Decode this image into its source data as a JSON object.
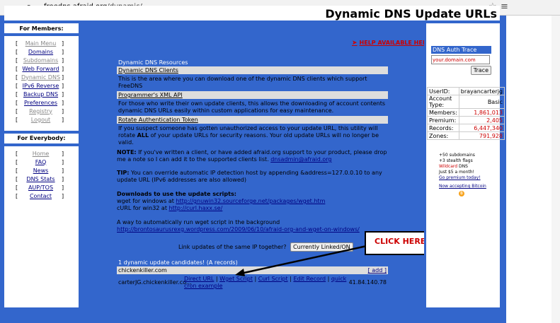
{
  "browser": {
    "url_host": "freedns.afraid.org",
    "url_path": "/dynamic/"
  },
  "header": {
    "title": "Dynamic DNS Update URLs"
  },
  "help_link": "HELP AVAILABLE HERE",
  "members": {
    "title": "For Members:",
    "items": [
      {
        "label": "Main Menu",
        "grey": true
      },
      {
        "label": "Domains",
        "grey": false
      },
      {
        "label": "Subdomains",
        "grey": true
      },
      {
        "label": "Web Forward",
        "grey": false
      },
      {
        "label": "Dynamic DNS",
        "grey": true
      },
      {
        "label": "IPv6 Reverse",
        "grey": false
      },
      {
        "label": "Backup DNS",
        "grey": false
      },
      {
        "label": "Preferences",
        "grey": false
      },
      {
        "label": "Registry",
        "grey": true
      },
      {
        "label": "Logout",
        "grey": true
      }
    ]
  },
  "everybody": {
    "title": "For Everybody:",
    "items": [
      {
        "label": "Home",
        "grey": true
      },
      {
        "label": "FAQ",
        "grey": false
      },
      {
        "label": "News",
        "grey": false
      },
      {
        "label": "DNS Stats",
        "grey": false
      },
      {
        "label": "AUP/TOS",
        "grey": false
      },
      {
        "label": "Contact",
        "grey": false
      }
    ]
  },
  "resources": {
    "header": "Dynamic DNS Resources",
    "clients_title": "Dynamic DNS Clients",
    "clients_text": "This is the area where you can download one of the dynamic DNS clients which support FreeDNS",
    "xml_title": "Programmer's XML API",
    "xml_text": "For those who write their own update clients, this allows the downloading of account contents dynamic DNS URLs easily within custom applications for easy maintenance.",
    "rotate_title": "Rotate Authentication Token",
    "rotate_text_a": "If you suspect someone has gotten unauthorized access to your update URL, this utility will rotate ",
    "rotate_text_b": "ALL",
    "rotate_text_c": " of your update URLs for security reasons. Your old update URLs will no longer be valid."
  },
  "note": {
    "label": "NOTE:",
    "text": " If you've written a client, or have added afraid.org support to your product, please drop me a note so I can add it to the supported clients list. ",
    "email": "dnsadmin@afraid.org"
  },
  "tip": {
    "label": "TIP:",
    "text": " You can override automatic IP detection host by appending &address=127.0.0.10 to any update URL (IPv6 addresses are also allowed)"
  },
  "downloads": {
    "title": "Downloads to use the update scripts:",
    "wget_label": "wget for windows at ",
    "wget_url": "http://gnuwin32.sourceforge.net/packages/wget.htm",
    "curl_label": "cURL for win32 at ",
    "curl_url": "http://curl.haxx.se/",
    "bg_text": "A way to automatically run wget script in the background",
    "bg_url": "http://brontosaurusrexg.wordpress.com/2009/06/10/afraid-org-and-wget-on-windows/"
  },
  "link_updates": {
    "label": "Link updates of the same IP together?",
    "button": "Currently Linked/ON"
  },
  "candidates": {
    "header": "1 dynamic update candidates! (A records)",
    "domain": "chickenkiller.com",
    "add": "[ add ]",
    "host": "carterJG.chickenkiller.co...",
    "links": [
      "Direct URL",
      "Wget Script",
      "Curl Script",
      "Edit Record",
      "quick cron example"
    ],
    "ip": "41.84.140.78"
  },
  "callout": "CLICK HERE",
  "auth": {
    "title": "DNS Auth Trace",
    "placeholder": "your.domain.com",
    "button": "Trace"
  },
  "stats": {
    "rows": [
      {
        "k": "UserID:",
        "v": "brayancarterjg",
        "red": false
      },
      {
        "k": "Account Type:",
        "v": "Basic",
        "red": false
      },
      {
        "k": "Members:",
        "v": "1,861,013",
        "red": true
      },
      {
        "k": "Premium:",
        "v": "2,405",
        "red": true
      },
      {
        "k": "Records:",
        "v": "6,447,340",
        "red": true
      },
      {
        "k": "Zones:",
        "v": "791,928",
        "red": true
      }
    ]
  },
  "promo": {
    "l1": "+50 subdomains",
    "l2": "+3 stealth flags",
    "l3a": "Wildcard",
    "l3b": " DNS",
    "l4": "Just $5 a month!",
    "l5": "Go premium today!",
    "l6": "Now accepting Bitcoin"
  }
}
